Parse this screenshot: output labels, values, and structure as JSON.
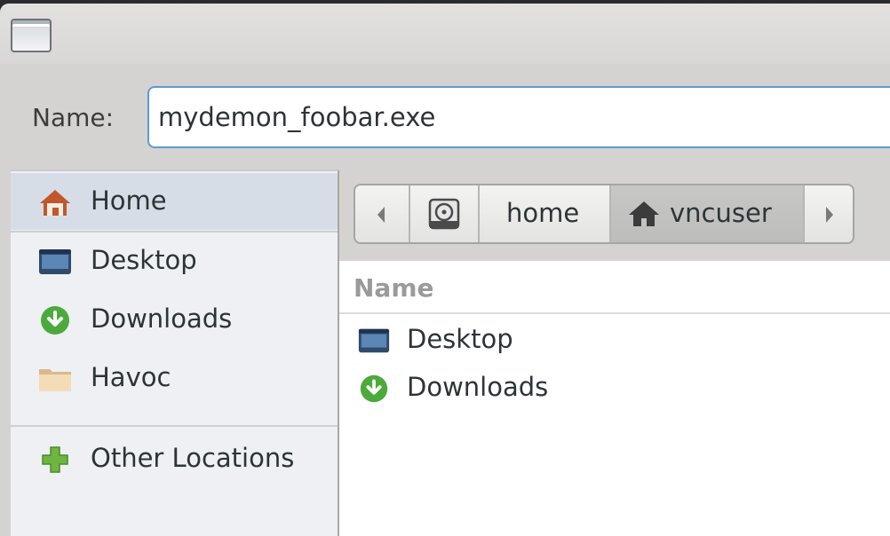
{
  "window": {
    "title_icon": "window-icon"
  },
  "name_field": {
    "label": "Name:",
    "value": "mydemon_foobar.exe"
  },
  "sidebar": {
    "items": [
      {
        "label": "Home",
        "icon": "home-icon",
        "selected": true
      },
      {
        "label": "Desktop",
        "icon": "desktop-icon"
      },
      {
        "label": "Downloads",
        "icon": "downloads-icon"
      },
      {
        "label": "Havoc",
        "icon": "folder-icon"
      }
    ],
    "other": {
      "label": "Other Locations",
      "icon": "plus-icon"
    }
  },
  "pathbar": {
    "back_icon": "chevron-left-icon",
    "drive_icon": "drive-icon",
    "segments": [
      {
        "label": "home"
      },
      {
        "label": "vncuser",
        "icon": "home-icon",
        "active": true
      }
    ],
    "forward_icon": "chevron-right-icon"
  },
  "file_list": {
    "column_name": "Name",
    "rows": [
      {
        "label": "Desktop",
        "icon": "desktop-icon"
      },
      {
        "label": "Downloads",
        "icon": "downloads-icon"
      }
    ]
  },
  "colors": {
    "input_border": "#5c9bd8",
    "selected_bg": "#d6dde6",
    "download_green": "#4caa3c"
  }
}
